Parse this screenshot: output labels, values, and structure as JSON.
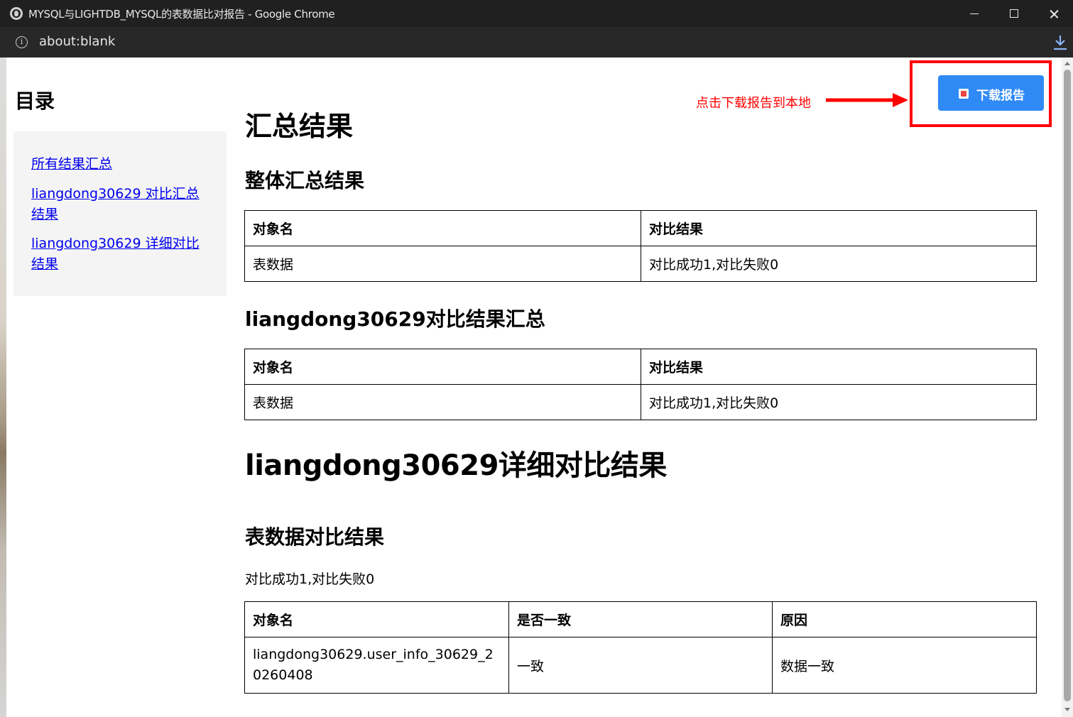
{
  "window": {
    "title": "MYSQL与LIGHTDB_MYSQL的表数据比对报告 - Google Chrome",
    "url": "about:blank",
    "icons": {
      "site": "globe-icon",
      "info": "info-icon",
      "download": "download-icon",
      "minimize": "minimize-icon",
      "maximize": "maximize-icon",
      "close": "close-icon"
    }
  },
  "sidebar": {
    "title": "目录",
    "links": [
      "所有结果汇总",
      "liangdong30629 对比汇总结果",
      "liangdong30629 详细对比结果"
    ]
  },
  "download": {
    "button_label": "下载报告",
    "annotation": "点击下载报告到本地",
    "annotation_color": "#ff0000",
    "button_color": "#2f8af5"
  },
  "summary": {
    "heading": "汇总结果",
    "overall": {
      "heading": "整体汇总结果",
      "headers": [
        "对象名",
        "对比结果"
      ],
      "rows": [
        [
          "表数据",
          "对比成功1,对比失败0"
        ]
      ]
    },
    "schema": {
      "heading": "liangdong30629对比结果汇总",
      "headers": [
        "对象名",
        "对比结果"
      ],
      "rows": [
        [
          "表数据",
          "对比成功1,对比失败0"
        ]
      ]
    }
  },
  "detail": {
    "heading": "liangdong30629详细对比结果",
    "table_section": {
      "heading": "表数据对比结果",
      "summary_text": "对比成功1,对比失败0",
      "headers": [
        "对象名",
        "是否一致",
        "原因"
      ],
      "rows": [
        [
          "liangdong30629.user_info_30629_20260408",
          "一致",
          "数据一致"
        ]
      ]
    }
  }
}
